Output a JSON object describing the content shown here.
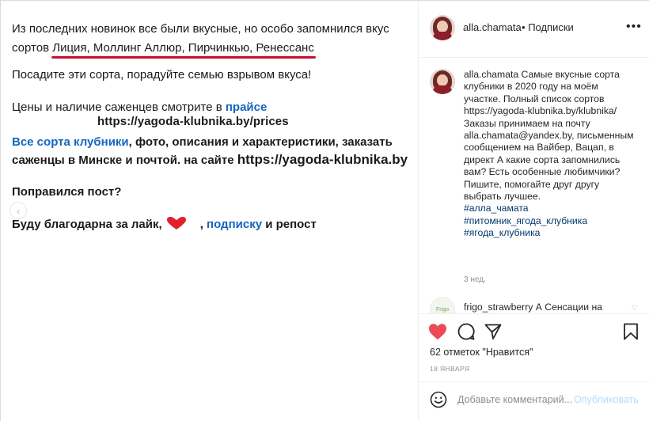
{
  "post_image": {
    "line1": "Из последних новинок все были вкусные, но особо запомнился вкус",
    "line2_prefix": "сортов ",
    "line2_varieties": "Лиция, Моллинг Аллюр, Пирчинкью, Ренессанс",
    "line3": "Посадите эти сорта, порадуйте семью взрывом вкуса!",
    "line4_text": "Цены и наличие саженцев смотрите в ",
    "line4_link": "прайсе",
    "line5_url": "https://yagoda-klubnika.by/prices",
    "line6_link": "Все сорта клубники",
    "line6_text": ", фото, описания и характеристики, заказать",
    "line7_text": "саженцы в Минске и почтой. на сайте ",
    "line7_url": "https://yagoda-klubnika.by",
    "line8": "Поправился пост?",
    "line9_text": "Буду благодарна за лайк,",
    "line9_sep": ", ",
    "line9_link": "подписку",
    "line9_end": " и репост",
    "accent_red": "#c8102e",
    "link_blue": "#1565c0"
  },
  "header": {
    "username": "alla.chamata",
    "separator": "•",
    "follow_label": "Подписки",
    "more_label": "•••"
  },
  "caption": {
    "username": "alla.chamata",
    "text": "Самые вкусные сорта клубники в 2020 году на моём участке. Полный список сортов https://yagoda-klubnika.by/klubnika/ Заказы принимаем на почту alla.chamata@yandex.by, письменным сообщением на Вайбер, Вацап, в директ А какие сорта запомнились вам? Есть особенные любимчики? Пишите, помогайте друг другу выбрать лучшее.",
    "hashtags": [
      "#алла_чамата",
      "#питомник_ягода_клубника",
      "#ягода_клубника"
    ],
    "time": "3 нед."
  },
  "comment2": {
    "avatar_label": "Frigo",
    "username": "frigo_strawberry",
    "text": "А Сенсации на"
  },
  "likes_text": "62 отметок \"Нравится\"",
  "date": "18 ЯНВАРЯ",
  "add_comment": {
    "placeholder": "Добавьте комментарий...",
    "publish_label": "Опубликовать"
  },
  "colors": {
    "like_red": "#ed4956",
    "publish_blue": "#b3dbff",
    "hashtag_blue": "#00376b"
  }
}
